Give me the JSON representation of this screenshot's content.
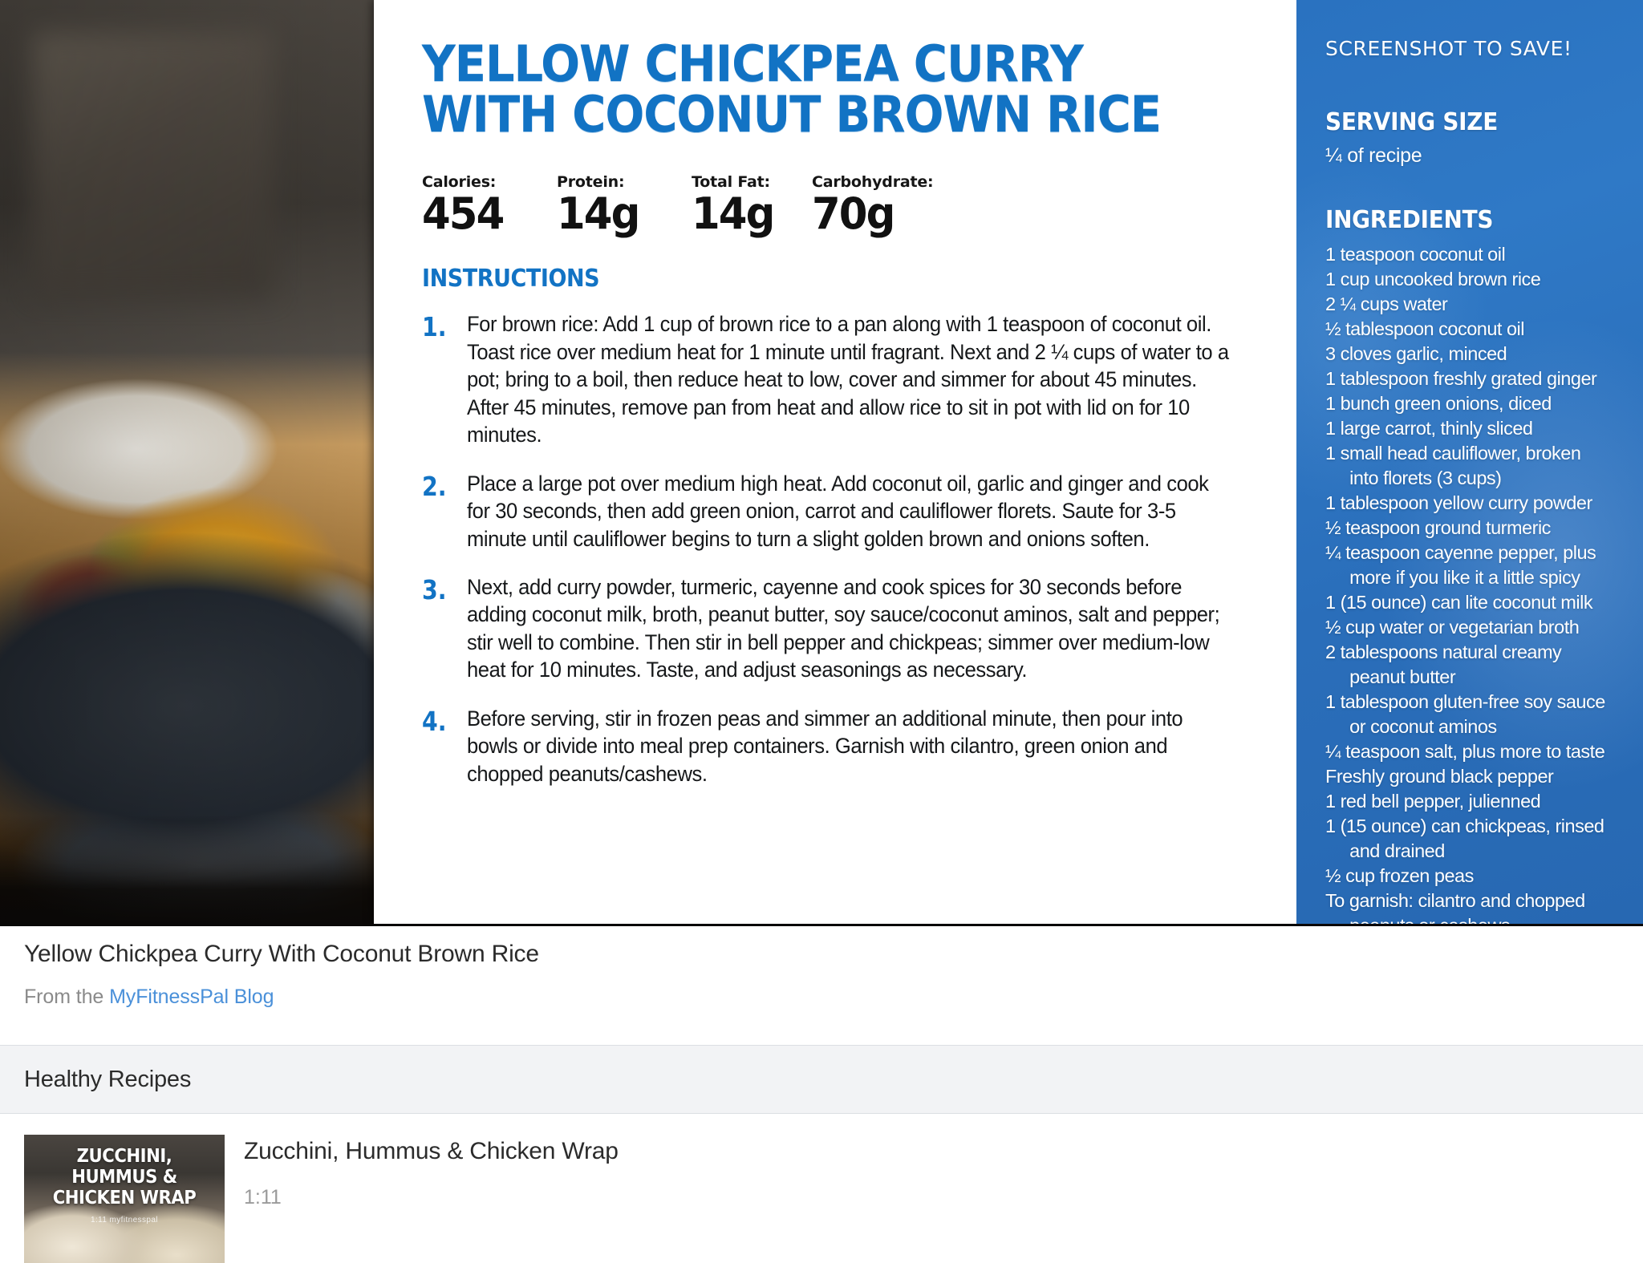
{
  "recipe_card": {
    "title_line1": "YELLOW CHICKPEA CURRY",
    "title_line2": "WITH COCONUT BROWN RICE",
    "nutrition": [
      {
        "label": "Calories:",
        "value": "454"
      },
      {
        "label": "Protein:",
        "value": "14g"
      },
      {
        "label": "Total Fat:",
        "value": "14g"
      },
      {
        "label": "Carbohydrate:",
        "value": "70g"
      }
    ],
    "instructions_heading": "INSTRUCTIONS",
    "steps": [
      {
        "num": "1.",
        "text": "For brown rice: Add 1 cup of brown rice to a pan along with 1 teaspoon of coconut oil. Toast rice over medium heat for 1 minute until fragrant. Next and 2 ¼ cups of water to a pot; bring to a boil, then reduce heat to low, cover and simmer for about 45 minutes. After 45 minutes, remove pan from heat and allow rice to sit in pot with lid on for 10 minutes."
      },
      {
        "num": "2.",
        "text": "Place a large pot over medium high heat. Add coconut oil, garlic and ginger and cook for 30 seconds, then add green onion, carrot and cauliflower florets. Saute for 3-5 minute until cauliflower begins to turn a slight golden brown and onions soften."
      },
      {
        "num": "3.",
        "text": "Next, add curry powder, turmeric, cayenne and cook spices for 30 seconds before adding coconut milk, broth, peanut butter, soy sauce/coconut aminos, salt and pepper; stir well to combine. Then stir in bell pepper and chickpeas; simmer over medium-low heat for 10 minutes. Taste, and adjust seasonings as necessary."
      },
      {
        "num": "4.",
        "text": "Before serving, stir in frozen peas and simmer an additional minute, then pour into bowls or divide into meal prep containers. Garnish with cilantro, green onion and chopped peanuts/cashews."
      }
    ]
  },
  "blue_panel": {
    "callout": "SCREENSHOT TO SAVE!",
    "serving_size_heading": "SERVING SIZE",
    "serving_size_value": "¼ of recipe",
    "ingredients_heading": "INGREDIENTS",
    "ingredients": [
      "1 teaspoon coconut oil",
      "1 cup uncooked brown rice",
      "2 ¼ cups water",
      "½ tablespoon coconut oil",
      "3 cloves garlic, minced",
      "1 tablespoon freshly grated ginger",
      "1 bunch green onions, diced",
      "1 large carrot, thinly sliced",
      "1 small head cauliflower, broken\n     into florets (3 cups)",
      "1 tablespoon yellow curry powder",
      "½ teaspoon ground turmeric",
      "¼ teaspoon cayenne pepper, plus\n     more if you like it a little spicy",
      "1 (15 ounce) can lite coconut milk",
      "½ cup water or vegetarian broth",
      "2 tablespoons natural creamy\n     peanut butter",
      "1 tablespoon gluten-free soy sauce\n     or coconut aminos",
      "¼ teaspoon salt, plus more to taste",
      "Freshly ground black pepper",
      "1 red bell pepper, julienned",
      "1 (15 ounce) can chickpeas, rinsed\n     and drained",
      "½ cup frozen peas",
      "To garnish: cilantro and chopped\n     peanuts or cashews"
    ],
    "accent_color": "#2a72c0"
  },
  "meta": {
    "title": "Yellow Chickpea Curry With Coconut Brown Rice",
    "from_prefix": "From the ",
    "source_link": "MyFitnessPal Blog",
    "link_color": "#4a90d9"
  },
  "section": {
    "heading": "Healthy Recipes"
  },
  "related": [
    {
      "title": "Zucchini, Hummus & Chicken Wrap",
      "duration": "1:11",
      "thumb_text": "ZUCCHINI,\nHUMMUS &\nCHICKEN WRAP",
      "thumb_brand": "1:11 myfitnesspal"
    }
  ],
  "theme": {
    "title_blue": "#1273c4",
    "body_text": "#16181a",
    "section_bg": "#f2f3f5"
  }
}
